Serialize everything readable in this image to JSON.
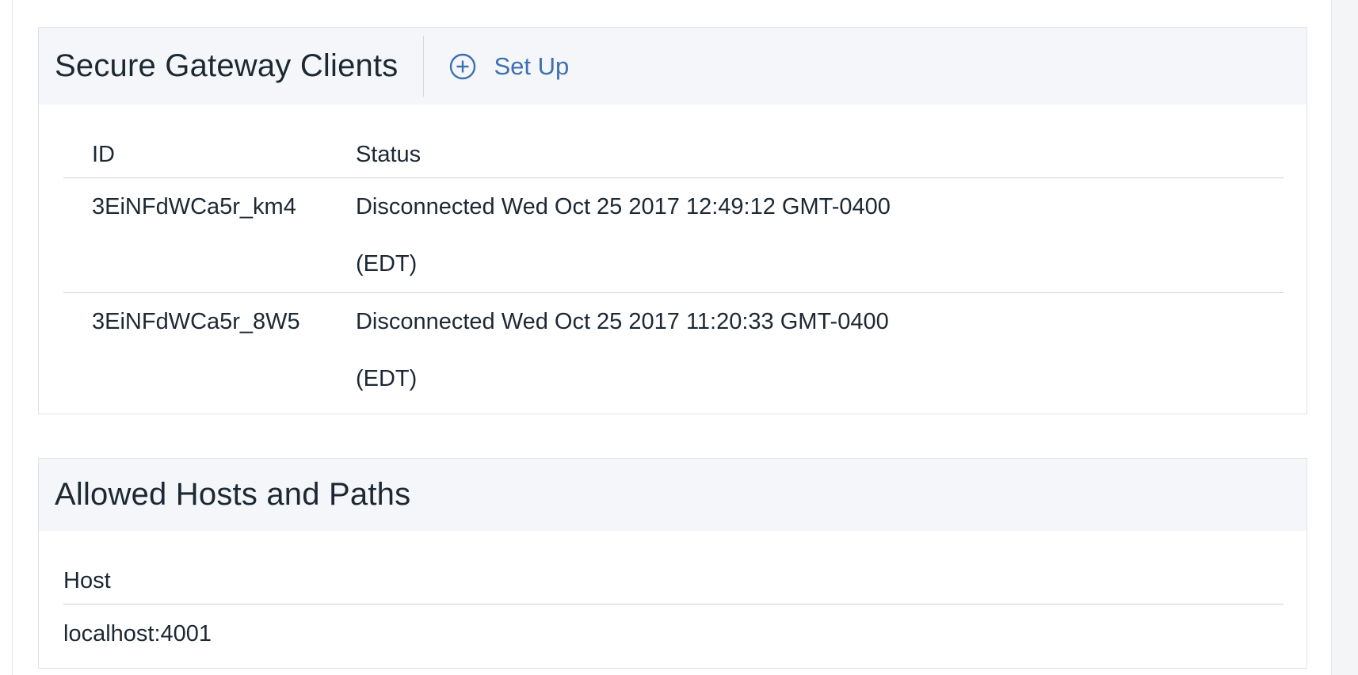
{
  "secure_gateway_clients": {
    "title": "Secure Gateway Clients",
    "setup_button": {
      "icon": "plus-circle-icon",
      "label": "Set Up"
    },
    "columns": [
      "ID",
      "Status"
    ],
    "rows": [
      {
        "id": "3EiNFdWCa5r_km4",
        "status_line1": "Disconnected Wed Oct 25 2017 12:49:12 GMT-0400",
        "status_line2": "(EDT)"
      },
      {
        "id": "3EiNFdWCa5r_8W5",
        "status_line1": "Disconnected Wed Oct 25 2017 11:20:33 GMT-0400",
        "status_line2": "(EDT)"
      }
    ]
  },
  "allowed_hosts": {
    "title": "Allowed Hosts and Paths",
    "columns": [
      "Host"
    ],
    "rows": [
      {
        "host": "localhost:4001"
      }
    ]
  },
  "colors": {
    "accent": "#3d70b2",
    "header_background": "#f4f6f9",
    "text": "#1c2833",
    "border": "#dfe3e8"
  }
}
